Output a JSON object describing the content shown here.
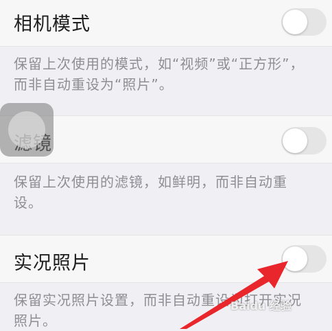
{
  "settings": [
    {
      "title": "相机模式",
      "description": "保留上次使用的模式，如“视频”或“正方形”，而非自动重设为“照片”。",
      "enabled": false
    },
    {
      "title": "滤镜",
      "description": "保留上次使用的滤镜，如鲜明，而非自动重设。",
      "enabled": false
    },
    {
      "title": "实况照片",
      "description": "保留实况照片设置，而非自动重设为打开实况照片。",
      "enabled": false
    }
  ],
  "watermark": "Baidu 经验",
  "colors": {
    "background": "#efeff4",
    "row": "#f7f7f7",
    "toggle_off": "#e5e5e5",
    "arrow": "#e8262b"
  }
}
